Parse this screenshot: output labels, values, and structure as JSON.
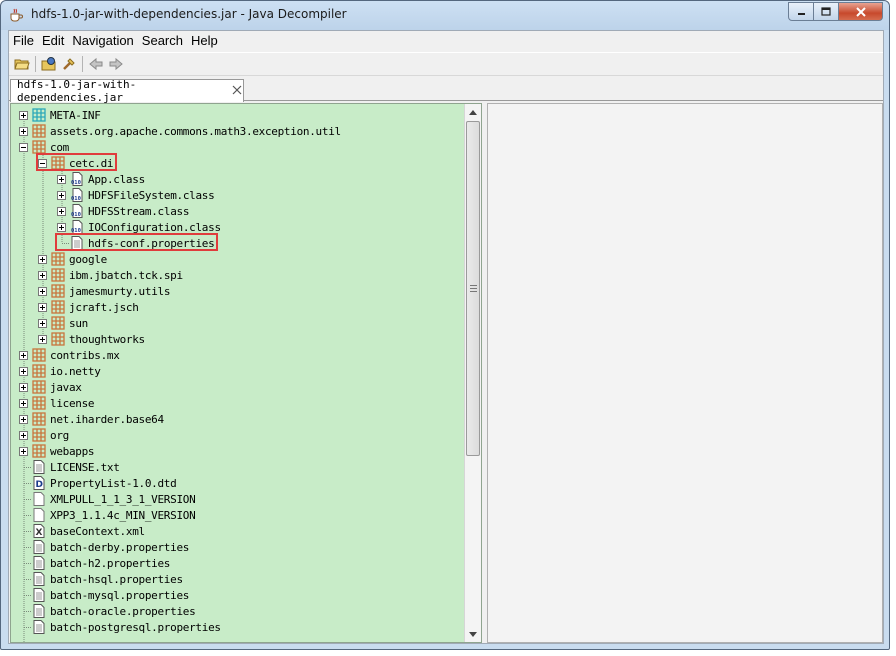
{
  "window": {
    "title": "hdfs-1.0-jar-with-dependencies.jar - Java Decompiler"
  },
  "menu": [
    "File",
    "Edit",
    "Navigation",
    "Search",
    "Help"
  ],
  "toolbar": {
    "buttons": [
      "open-file-icon",
      "open-type-icon",
      "find-icon",
      "back-icon",
      "forward-icon"
    ]
  },
  "tab": {
    "label": "hdfs-1.0-jar-with-dependencies.jar"
  },
  "tree": [
    {
      "label": "META-INF",
      "icon": "package-cyan",
      "level": 0,
      "expander": "plus"
    },
    {
      "label": "assets.org.apache.commons.math3.exception.util",
      "icon": "package",
      "level": 0,
      "expander": "plus"
    },
    {
      "label": "com",
      "icon": "package",
      "level": 0,
      "expander": "minus"
    },
    {
      "label": "cetc.di",
      "icon": "package",
      "level": 1,
      "expander": "minus"
    },
    {
      "label": "App.class",
      "icon": "class",
      "level": 2,
      "expander": "plus"
    },
    {
      "label": "HDFSFileSystem.class",
      "icon": "class",
      "level": 2,
      "expander": "plus"
    },
    {
      "label": "HDFSStream.class",
      "icon": "class",
      "level": 2,
      "expander": "plus"
    },
    {
      "label": "IOConfiguration.class",
      "icon": "class",
      "level": 2,
      "expander": "plus"
    },
    {
      "label": "hdfs-conf.properties",
      "icon": "file",
      "level": 2,
      "expander": "none"
    },
    {
      "label": "google",
      "icon": "package",
      "level": 1,
      "expander": "plus"
    },
    {
      "label": "ibm.jbatch.tck.spi",
      "icon": "package",
      "level": 1,
      "expander": "plus"
    },
    {
      "label": "jamesmurty.utils",
      "icon": "package",
      "level": 1,
      "expander": "plus"
    },
    {
      "label": "jcraft.jsch",
      "icon": "package",
      "level": 1,
      "expander": "plus"
    },
    {
      "label": "sun",
      "icon": "package",
      "level": 1,
      "expander": "plus"
    },
    {
      "label": "thoughtworks",
      "icon": "package",
      "level": 1,
      "expander": "plus"
    },
    {
      "label": "contribs.mx",
      "icon": "package",
      "level": 0,
      "expander": "plus"
    },
    {
      "label": "io.netty",
      "icon": "package",
      "level": 0,
      "expander": "plus"
    },
    {
      "label": "javax",
      "icon": "package",
      "level": 0,
      "expander": "plus"
    },
    {
      "label": "license",
      "icon": "package",
      "level": 0,
      "expander": "plus"
    },
    {
      "label": "net.iharder.base64",
      "icon": "package",
      "level": 0,
      "expander": "plus"
    },
    {
      "label": "org",
      "icon": "package",
      "level": 0,
      "expander": "plus"
    },
    {
      "label": "webapps",
      "icon": "package",
      "level": 0,
      "expander": "plus"
    },
    {
      "label": "LICENSE.txt",
      "icon": "file",
      "level": 0,
      "expander": "none"
    },
    {
      "label": "PropertyList-1.0.dtd",
      "icon": "dtd",
      "level": 0,
      "expander": "none"
    },
    {
      "label": "XMLPULL_1_1_3_1_VERSION",
      "icon": "blank",
      "level": 0,
      "expander": "none"
    },
    {
      "label": "XPP3_1.1.4c_MIN_VERSION",
      "icon": "blank",
      "level": 0,
      "expander": "none"
    },
    {
      "label": "baseContext.xml",
      "icon": "xml",
      "level": 0,
      "expander": "none"
    },
    {
      "label": "batch-derby.properties",
      "icon": "file",
      "level": 0,
      "expander": "none"
    },
    {
      "label": "batch-h2.properties",
      "icon": "file",
      "level": 0,
      "expander": "none"
    },
    {
      "label": "batch-hsql.properties",
      "icon": "file",
      "level": 0,
      "expander": "none"
    },
    {
      "label": "batch-mysql.properties",
      "icon": "file",
      "level": 0,
      "expander": "none"
    },
    {
      "label": "batch-oracle.properties",
      "icon": "file",
      "level": 0,
      "expander": "none"
    },
    {
      "label": "batch-postgresql.properties",
      "icon": "file",
      "level": 0,
      "expander": "none"
    }
  ],
  "highlighted": [
    "cetc.di",
    "hdfs-conf.properties"
  ],
  "colors": {
    "tree_background": "#c8ecc8",
    "highlight": "#e03c3c",
    "package_icon": "#c8753c"
  }
}
